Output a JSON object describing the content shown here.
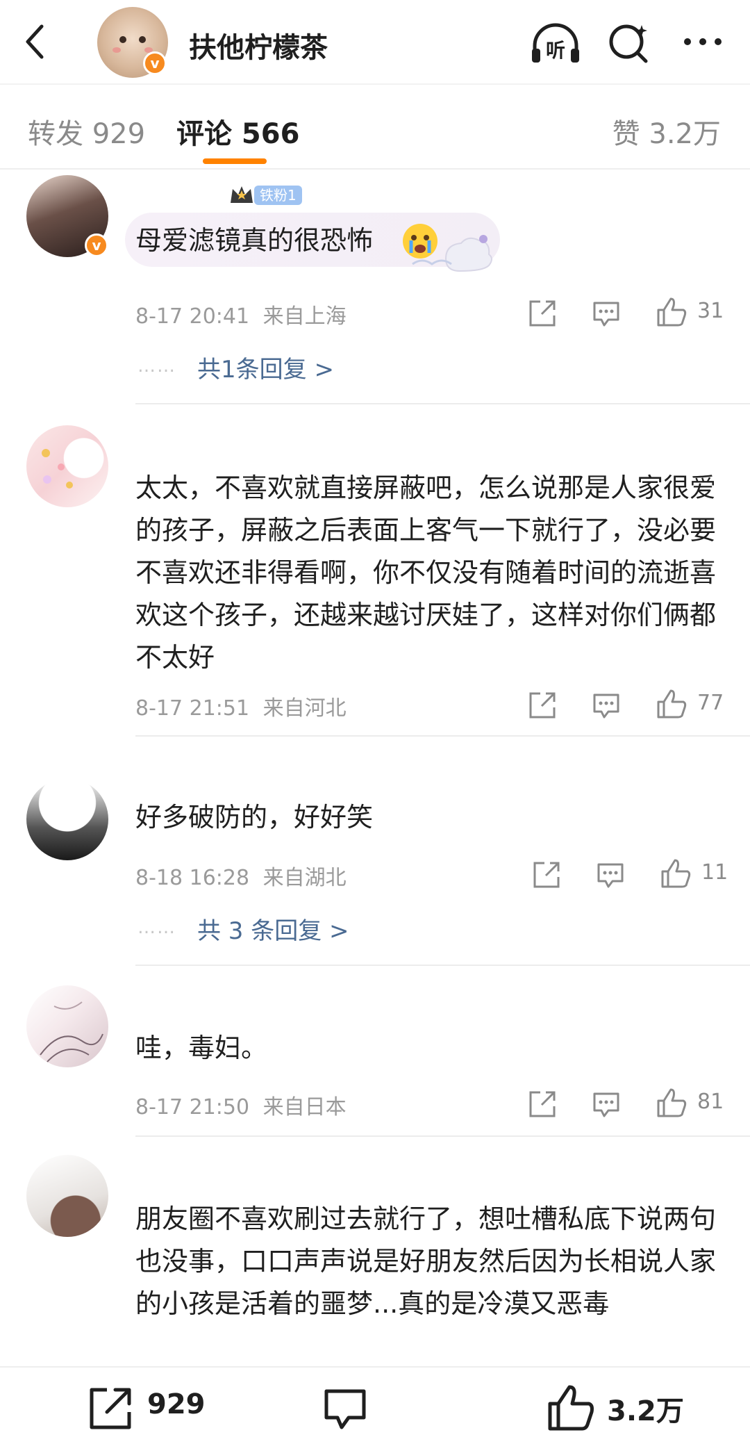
{
  "header": {
    "title": "扶他柠檬茶",
    "verified_badge": "v",
    "icons": [
      "back-arrow-icon",
      "listen-icon",
      "search-icon",
      "more-icon"
    ],
    "listen_label": "听"
  },
  "tabs": {
    "forward": "转发 929",
    "comments": "评论 566",
    "likes": "赞 3.2万",
    "active_color": "#ff8200"
  },
  "comments": [
    {
      "badge": "铁粉1",
      "text": "母爱滤镜真的很恐怖",
      "time": "8-17 20:41",
      "location": "来自上海",
      "likes": "31",
      "replies": "共1条回复 >",
      "dots": "……"
    },
    {
      "text": "太太，不喜欢就直接屏蔽吧，怎么说那是人家很爱的孩子，屏蔽之后表面上客气一下就行了，没必要不喜欢还非得看啊，你不仅没有随着时间的流逝喜欢这个孩子，还越来越讨厌娃了，这样对你们俩都不太好",
      "time": "8-17 21:51",
      "location": "来自河北",
      "likes": "77"
    },
    {
      "text": "好多破防的，好好笑",
      "time": "8-18 16:28",
      "location": "来自湖北",
      "likes": "11",
      "replies": "共 3 条回复 >",
      "dots": "……"
    },
    {
      "text": "哇，毒妇。",
      "time": "8-17 21:50",
      "location": "来自日本",
      "likes": "81"
    },
    {
      "text": "朋友圈不喜欢刷过去就行了，想吐槽私底下说两句也没事，口口声声说是好朋友然后因为长相说人家的小孩是活着的噩梦...真的是冷漠又恶毒"
    }
  ],
  "bottom_bar": {
    "forward_count": "929",
    "like_count": "3.2万"
  },
  "colors": {
    "accent": "#ff8200",
    "verified": "#f78a1f",
    "reply_link": "#4a6a92",
    "meta": "#9a9a9a"
  }
}
